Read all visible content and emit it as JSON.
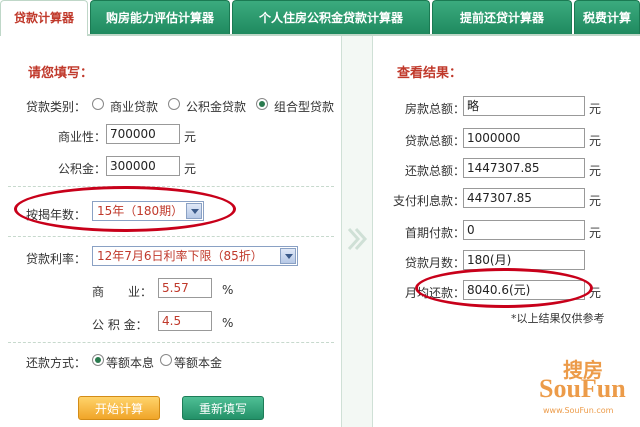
{
  "tabs": [
    {
      "label": "贷款计算器",
      "active": true
    },
    {
      "label": "购房能力评估计算器",
      "active": false
    },
    {
      "label": "个人住房公积金贷款计算器",
      "active": false
    },
    {
      "label": "提前还贷计算器",
      "active": false
    },
    {
      "label": "税费计算",
      "active": false
    }
  ],
  "left": {
    "title": "请您填写：",
    "loan_type_label": "贷款类别：",
    "loan_types": [
      "商业贷款",
      "公积金贷款",
      "组合型贷款"
    ],
    "loan_type_selected": "组合型贷款",
    "commercial_label": "商业性：",
    "commercial_value": "700000",
    "fund_label": "公积金：",
    "fund_value": "300000",
    "unit_yuan": "元",
    "years_label": "按揭年数：",
    "years_value": "15年（180期）",
    "rate_label": "贷款利率：",
    "rate_value": "12年7月6日利率下限（85折）",
    "commercial_rate_label": "商　　业：",
    "commercial_rate_value": "5.57",
    "fund_rate_label": "公 积 金：",
    "fund_rate_value": "4.5",
    "percent": "%",
    "repay_label": "还款方式：",
    "repay_methods": [
      "等额本息",
      "等额本金"
    ],
    "repay_selected": "等额本息",
    "start_button": "开始计算",
    "reset_button": "重新填写"
  },
  "right": {
    "title": "查看结果：",
    "rows": [
      {
        "label": "房款总额：",
        "value": "略",
        "unit": "元"
      },
      {
        "label": "贷款总额：",
        "value": "1000000",
        "unit": "元"
      },
      {
        "label": "还款总额：",
        "value": "1447307.85",
        "unit": "元"
      },
      {
        "label": "支付利息款：",
        "value": "447307.85",
        "unit": "元"
      },
      {
        "label": "首期付款：",
        "value": "0",
        "unit": "元"
      },
      {
        "label": "贷款月数：",
        "value": "180(月)",
        "unit": ""
      },
      {
        "label": "月均还款：",
        "value": "8040.6(元)",
        "unit": "元"
      }
    ],
    "note": "*以上结果仅供参考"
  },
  "watermark": {
    "cn": "搜房",
    "en": "SouFun",
    "url": "www.SouFun.com"
  },
  "colors": {
    "tab_green": "#1f8a5f",
    "title_red": "#c0392b",
    "ellipse_red": "#c8001a",
    "btn_orange": "#f0a528",
    "btn_green": "#239168"
  }
}
